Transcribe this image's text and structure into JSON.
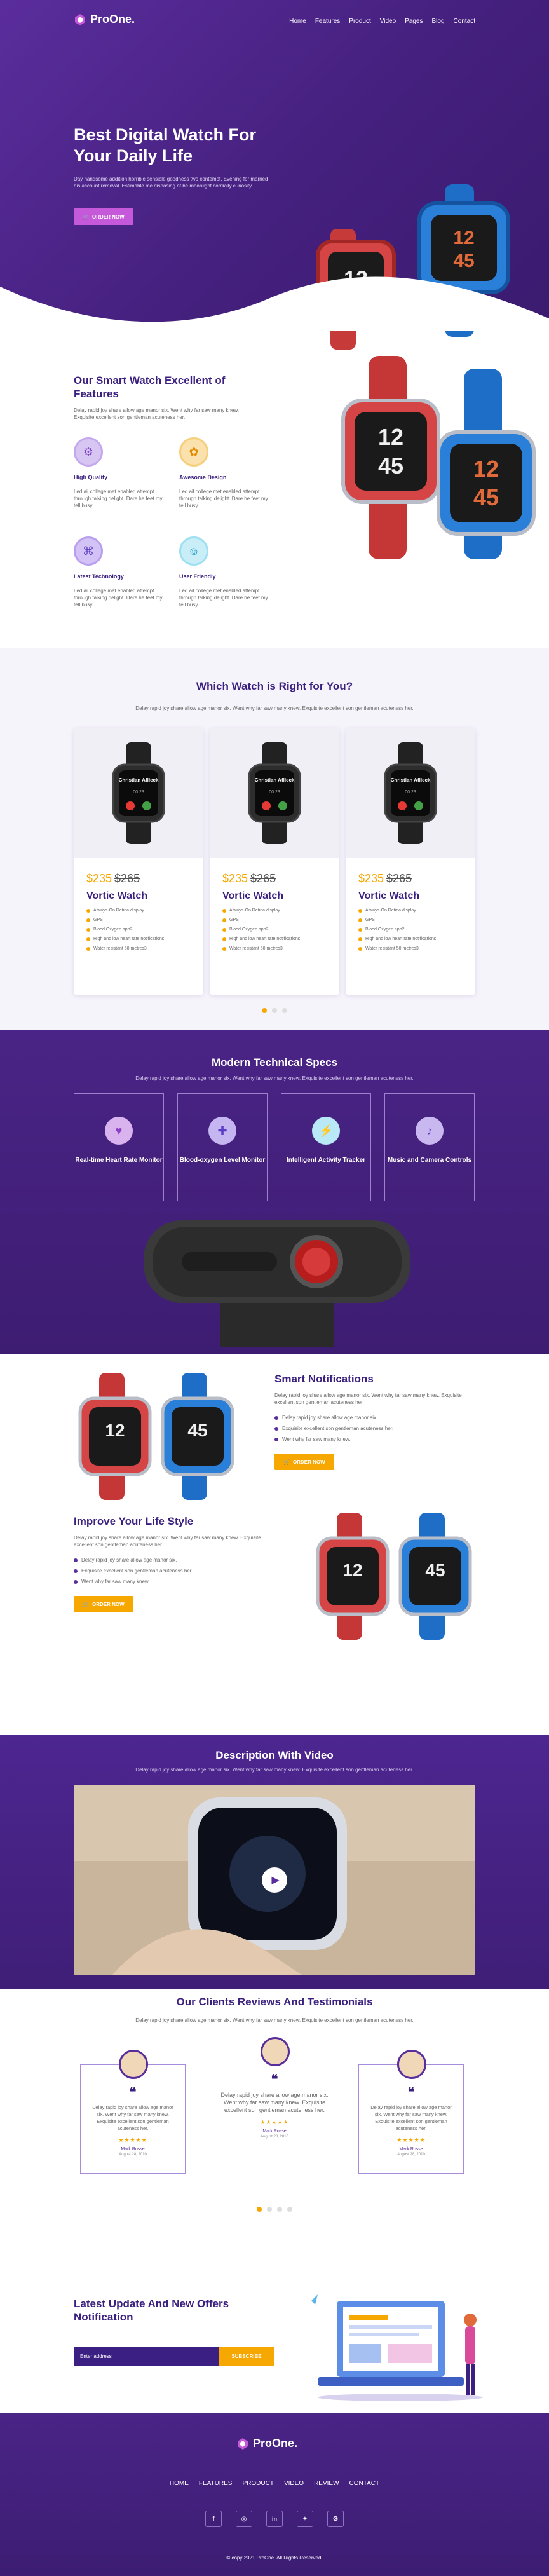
{
  "header": {
    "brand": "ProOne.",
    "nav": [
      "Home",
      "Features",
      "Product",
      "Video",
      "Pages",
      "Blog",
      "Contact"
    ]
  },
  "hero": {
    "title": "Best Digital Watch For Your Daily Life",
    "text": "Day handsome addition horrible sensible goodness two contempt. Evening for married his account removal. Estimable me disposing of be moonlight cordially curiosity.",
    "cta": "ORDER NOW"
  },
  "features": {
    "title": "Our Smart Watch Excellent of Features",
    "lead": "Delay rapid joy share allow age manor six. Went why far saw many knew. Exquisite excellent son gentleman acuteness her.",
    "items": [
      {
        "title": "High Quality",
        "text": "Led ail college met enabled attempt through talking delight. Dare he feet my tell busy."
      },
      {
        "title": "Awesome Design",
        "text": "Led ail college met enabled attempt through talking delight. Dare he feet my tell busy."
      },
      {
        "title": "Latest Technology",
        "text": "Led ail college met enabled attempt through talking delight. Dare he feet my tell busy."
      },
      {
        "title": "User Friendly",
        "text": "Led ail college met enabled attempt through talking delight. Dare he feet my tell busy."
      }
    ]
  },
  "products": {
    "title": "Which Watch is Right for You?",
    "subtitle": "Delay rapid joy share allow age manor six. Went why far saw many knew. Exquisite excellent son gentleman acuteness her.",
    "cards": [
      {
        "screen_name": "Christian Aflleck",
        "screen_time": "00:23",
        "price": "$235",
        "old_price": "$265",
        "name": "Vortic Watch",
        "specs": [
          "Always-On Retina display",
          "GPS",
          "Blood Oxygen app2",
          "High and low heart rate notifications",
          "Water resistant 50 metres3"
        ]
      },
      {
        "screen_name": "Christian Aflleck",
        "screen_time": "00:23",
        "price": "$235",
        "old_price": "$265",
        "name": "Vortic Watch",
        "specs": [
          "Always-On Retina display",
          "GPS",
          "Blood Oxygen app2",
          "High and low heart rate notifications",
          "Water resistant 50 metres3"
        ]
      },
      {
        "screen_name": "Christian Aflleck",
        "screen_time": "00:23",
        "price": "$235",
        "old_price": "$265",
        "name": "Vortic Watch",
        "specs": [
          "Always-On Retina display",
          "GPS",
          "Blood Oxygen app2",
          "High and low heart rate notifications",
          "Water resistant 50 metres3"
        ]
      }
    ]
  },
  "specs": {
    "title": "Modern Technical Specs",
    "subtitle": "Delay rapid joy share allow age manor six. Went why far saw many knew. Exquisite excellent son gentleman acuteness her.",
    "items": [
      "Real-time Heart Rate Monitor",
      "Blood-oxygen Level Monitor",
      "Intelligent Activity Tracker",
      "Music and Camera Controls"
    ]
  },
  "smart": {
    "title": "Smart Notifications",
    "text": "Delay rapid joy share allow age manor six. Went why far saw many knew. Exquisite excellent son gentleman acuteness her.",
    "list": [
      "Delay rapid joy share allow age manor six.",
      "Exquisite excellent son gentleman acuteness her.",
      "Went why far saw many knew."
    ],
    "cta": "ORDER NOW"
  },
  "lifestyle": {
    "title": "Improve Your Life Style",
    "text": "Delay rapid joy share allow age manor six. Went why far saw many knew. Exquisite excellent son gentleman acuteness her.",
    "list": [
      "Delay rapid joy share allow age manor six.",
      "Exquisite excellent son gentleman acuteness her.",
      "Went why far saw many knew."
    ],
    "cta": "ORDER NOW"
  },
  "video": {
    "title": "Description With Video",
    "subtitle": "Delay rapid joy share allow age manor six. Went why far saw many knew. Exquisite excellent son gentleman acuteness her."
  },
  "testimonials": {
    "title": "Our Clients Reviews And Testimonials",
    "subtitle": "Delay rapid joy share allow age manor six. Went why far saw many knew. Exquisite excellent son gentleman acuteness her.",
    "items": [
      {
        "text": "Delay rapid joy share allow age manor six. Went why far saw many knew. Exquisite excellent son gentleman acuteness her.",
        "stars": "★★★★★",
        "name": "Mark Rosse",
        "date": "August 28, 2010"
      },
      {
        "text": "Delay rapid joy share allow age manor six. Went why far saw many knew. Exquisite excellent son gentleman acuteness her.",
        "stars": "★★★★★",
        "name": "Mark Rosse",
        "date": "August 28, 2010"
      },
      {
        "text": "Delay rapid joy share allow age manor six. Went why far saw many knew. Exquisite excellent son gentleman acuteness her.",
        "stars": "★★★★★",
        "name": "Mark Rosse",
        "date": "August 28, 2010"
      }
    ]
  },
  "newsletter": {
    "title": "Latest Update And New Offers Notification",
    "placeholder": "Enter address",
    "button": "SUBSCRIBE"
  },
  "footer": {
    "brand": "ProOne.",
    "nav": [
      "HOME",
      "FEATURES",
      "PRODUCT",
      "VIDEO",
      "REVIEW",
      "CONTACT"
    ],
    "social": [
      "facebook-icon",
      "instagram-icon",
      "linkedin-icon",
      "twitter-icon",
      "google-icon"
    ],
    "copyright": "© copy 2021 ProOne. All Rights Reserved."
  },
  "colors": {
    "primary": "#4a2486",
    "accent": "#f6a800",
    "pink": "#c659d9",
    "heading": "#3b2080"
  }
}
